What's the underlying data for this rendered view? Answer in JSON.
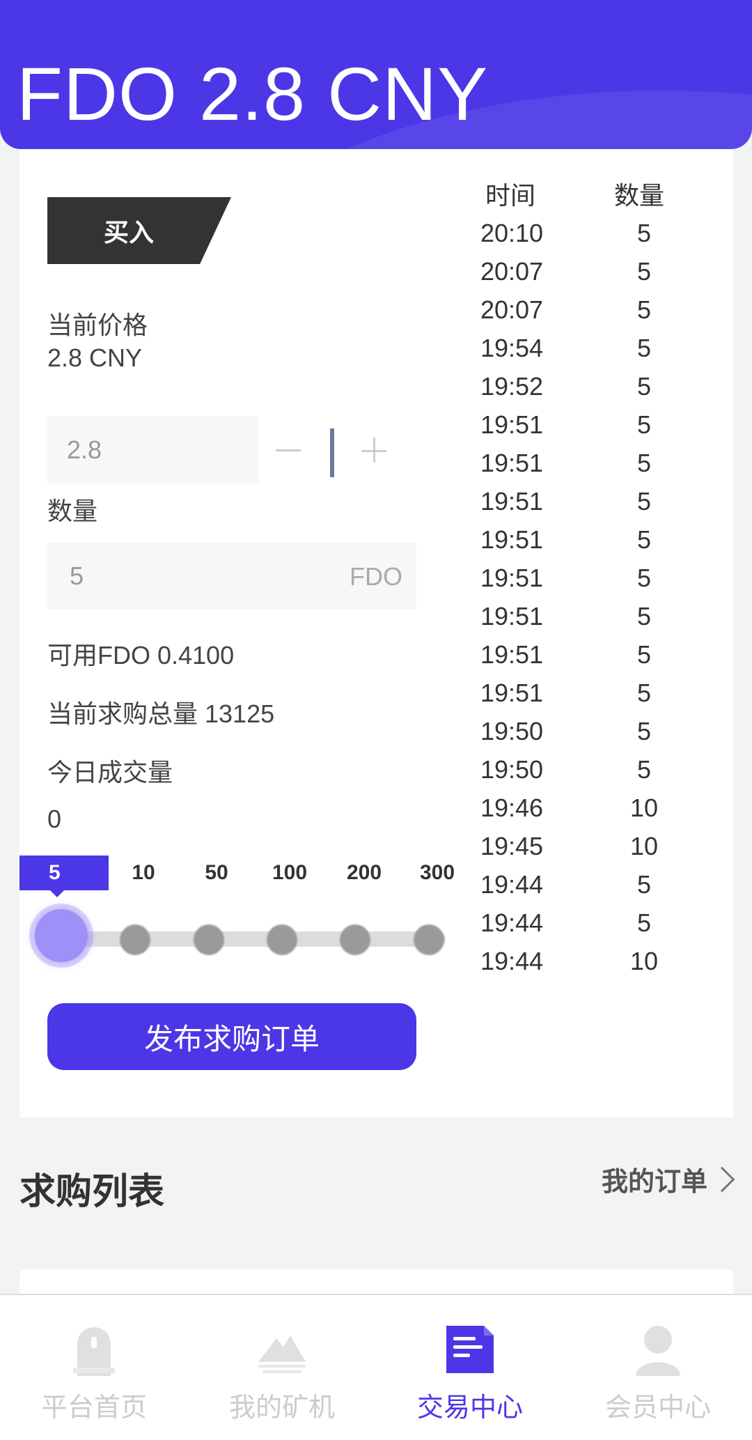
{
  "header": {
    "title": "FDO 2.8 CNY"
  },
  "order": {
    "buy_label": "买入",
    "price_title": "当前价格",
    "price_value": "2.8 CNY",
    "price_input_value": "2.8",
    "qty_title": "数量",
    "qty_input_value": "5",
    "qty_unit": "FDO",
    "available": "可用FDO 0.4100",
    "total_demand": "当前求购总量 13125",
    "today_volume_label": "今日成交量",
    "today_volume_value": "0",
    "presets": [
      "5",
      "10",
      "50",
      "100",
      "200",
      "300"
    ],
    "selected_preset": "5",
    "publish_label": "发布求购订单"
  },
  "trades": {
    "header_time": "时间",
    "header_qty": "数量",
    "rows": [
      {
        "time": "20:10",
        "qty": "5"
      },
      {
        "time": "20:07",
        "qty": "5"
      },
      {
        "time": "20:07",
        "qty": "5"
      },
      {
        "time": "19:54",
        "qty": "5"
      },
      {
        "time": "19:52",
        "qty": "5"
      },
      {
        "time": "19:51",
        "qty": "5"
      },
      {
        "time": "19:51",
        "qty": "5"
      },
      {
        "time": "19:51",
        "qty": "5"
      },
      {
        "time": "19:51",
        "qty": "5"
      },
      {
        "time": "19:51",
        "qty": "5"
      },
      {
        "time": "19:51",
        "qty": "5"
      },
      {
        "time": "19:51",
        "qty": "5"
      },
      {
        "time": "19:51",
        "qty": "5"
      },
      {
        "time": "19:50",
        "qty": "5"
      },
      {
        "time": "19:50",
        "qty": "5"
      },
      {
        "time": "19:46",
        "qty": "10"
      },
      {
        "time": "19:45",
        "qty": "10"
      },
      {
        "time": "19:44",
        "qty": "5"
      },
      {
        "time": "19:44",
        "qty": "5"
      },
      {
        "time": "19:44",
        "qty": "10"
      }
    ]
  },
  "list_section": {
    "title": "求购列表",
    "my_orders_label": "我的订单"
  },
  "tabbar": {
    "items": [
      {
        "label": "平台首页",
        "icon": "home-icon"
      },
      {
        "label": "我的矿机",
        "icon": "mountain-icon"
      },
      {
        "label": "交易中心",
        "icon": "document-icon",
        "active": true
      },
      {
        "label": "会员中心",
        "icon": "user-icon"
      }
    ]
  },
  "colors": {
    "accent": "#4b37e6",
    "dark": "#333333",
    "inactive": "#cccccc"
  }
}
